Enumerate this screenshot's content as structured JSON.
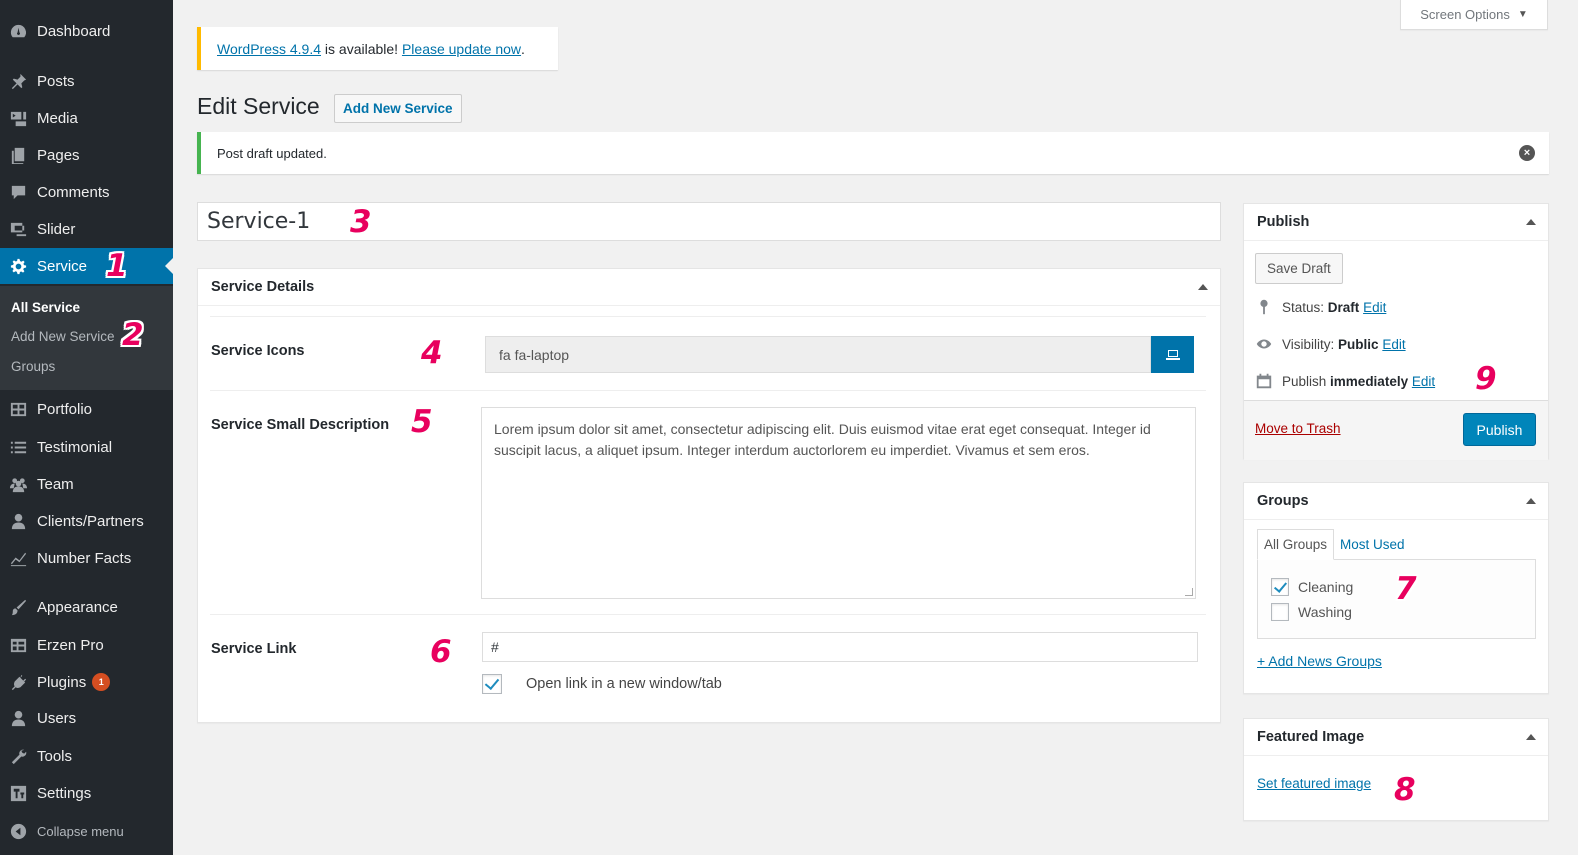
{
  "sidebar": {
    "items": [
      {
        "label": "Dashboard",
        "icon": "dashboard-icon"
      },
      {
        "label": "Posts",
        "icon": "pin-icon"
      },
      {
        "label": "Media",
        "icon": "media-icon"
      },
      {
        "label": "Pages",
        "icon": "pages-icon"
      },
      {
        "label": "Comments",
        "icon": "comments-icon"
      },
      {
        "label": "Slider",
        "icon": "slider-icon"
      },
      {
        "label": "Service",
        "icon": "gear-icon",
        "current": true
      },
      {
        "label": "Portfolio",
        "icon": "portfolio-icon"
      },
      {
        "label": "Testimonial",
        "icon": "list-icon"
      },
      {
        "label": "Team",
        "icon": "team-icon"
      },
      {
        "label": "Clients/Partners",
        "icon": "user-icon"
      },
      {
        "label": "Number Facts",
        "icon": "chart-icon"
      },
      {
        "label": "Appearance",
        "icon": "brush-icon"
      },
      {
        "label": "Erzen Pro",
        "icon": "table-icon"
      },
      {
        "label": "Plugins",
        "icon": "plug-icon",
        "badge": "1"
      },
      {
        "label": "Users",
        "icon": "user-icon"
      },
      {
        "label": "Tools",
        "icon": "wrench-icon"
      },
      {
        "label": "Settings",
        "icon": "settings-icon"
      }
    ],
    "submenu": [
      "All Service",
      "Add New Service",
      "Groups"
    ],
    "collapse_label": "Collapse menu"
  },
  "screen_options": {
    "label": "Screen Options"
  },
  "update_nag": {
    "version_link": "WordPress 4.9.4",
    "middle_text": " is available! ",
    "update_link": "Please update now",
    "end": "."
  },
  "page": {
    "title": "Edit Service",
    "add_new_label": "Add New Service"
  },
  "notice": {
    "text": "Post draft updated."
  },
  "post_title": "Service-1",
  "service_details": {
    "heading": "Service Details",
    "icons_label": "Service Icons",
    "icons_value": "fa fa-laptop",
    "description_label": "Service Small Description",
    "description_value": "Lorem ipsum dolor sit amet, consectetur adipiscing elit. Duis euismod vitae erat eget consequat. Integer id suscipit lacus, a aliquet ipsum. Integer interdum auctorlorem eu imperdiet. Vivamus et sem eros.",
    "link_label": "Service Link",
    "link_value": "#",
    "open_new_label": "Open link in a new window/tab",
    "open_new_checked": true
  },
  "publish": {
    "heading": "Publish",
    "save_draft": "Save Draft",
    "status_label": "Status:",
    "status_value": "Draft",
    "visibility_label": "Visibility:",
    "visibility_value": "Public",
    "publish_label": "Publish",
    "publish_value": "immediately",
    "edit_label": "Edit",
    "trash_label": "Move to Trash",
    "publish_button": "Publish"
  },
  "groups": {
    "heading": "Groups",
    "tab_all": "All Groups",
    "tab_most_used": "Most Used",
    "items": [
      {
        "label": "Cleaning",
        "checked": true
      },
      {
        "label": "Washing",
        "checked": false
      }
    ],
    "add_link": "+ Add News Groups"
  },
  "featured_image": {
    "heading": "Featured Image",
    "set_link": "Set featured image"
  },
  "annotations": [
    "1",
    "2",
    "3",
    "4",
    "5",
    "6",
    "7",
    "8",
    "9"
  ],
  "colors": {
    "sidebar_bg": "#23282d",
    "accent": "#0073aa",
    "annotation": "#e8005e",
    "update_border": "#ffba00",
    "success_border": "#46b450"
  }
}
